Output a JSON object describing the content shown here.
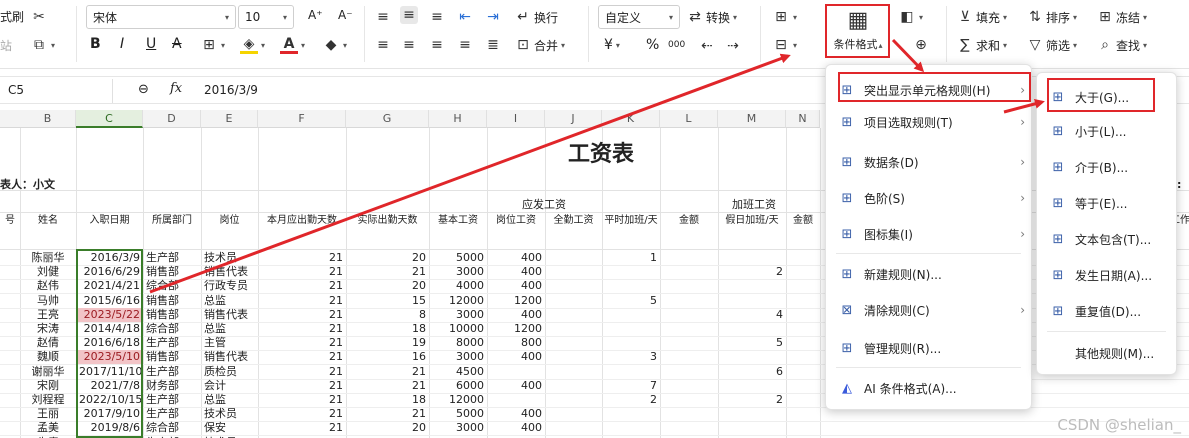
{
  "ribbon": {
    "format_painter": "式刷",
    "paste_partial": "站",
    "font_name": "宋体",
    "font_size": "10",
    "grow_font": "A⁺",
    "shrink_font": "A⁻",
    "bold": "B",
    "italic": "I",
    "underline": "U",
    "strike": "A",
    "number_format": "自定义",
    "convert": "转换",
    "wrap": "换行",
    "merge": "合并",
    "currency": "¥",
    "percent": "%",
    "thousands": "000",
    "cond_format": "条件格式",
    "fill": "填充",
    "sum": "求和",
    "sort": "排序",
    "filter": "筛选",
    "freeze": "冻结",
    "find": "查找",
    "colors": {
      "highlight": "#f5d400",
      "font": "#e0262a",
      "accent_red": "#e0262a"
    }
  },
  "formula_bar": {
    "cell_ref": "C5",
    "fx": "fx",
    "value": "2016/3/9"
  },
  "columns": [
    "B",
    "C",
    "D",
    "E",
    "F",
    "G",
    "H",
    "I",
    "J",
    "K",
    "L",
    "M",
    "N"
  ],
  "sheet": {
    "title": "工资表",
    "creator": "表人：小文",
    "right_fragment": "计:",
    "group_headers": {
      "wage": "应发工资",
      "overtime": "加班工资"
    },
    "headers": [
      "号",
      "姓名",
      "入职日期",
      "所属部门",
      "岗位",
      "本月应出勤天数",
      "实际出勤天数",
      "基本工资",
      "岗位工资",
      "全勤工资",
      "平时加班/天",
      "金额",
      "假日加班/天",
      "金额",
      "工作"
    ],
    "rows": [
      [
        "",
        "陈丽华",
        "2016/3/9",
        "生产部",
        "技术员",
        "21",
        "20",
        "5000",
        "400",
        "",
        "1",
        "",
        "",
        ""
      ],
      [
        "",
        "刘健",
        "2016/6/29",
        "销售部",
        "销售代表",
        "21",
        "21",
        "3000",
        "400",
        "",
        "",
        "",
        "2",
        ""
      ],
      [
        "",
        "赵伟",
        "2021/4/21",
        "综合部",
        "行政专员",
        "21",
        "20",
        "4000",
        "400",
        "",
        "",
        "",
        "",
        ""
      ],
      [
        "",
        "马帅",
        "2015/6/16",
        "销售部",
        "总监",
        "21",
        "15",
        "12000",
        "1200",
        "",
        "5",
        "",
        "",
        ""
      ],
      [
        "",
        "王亮",
        "2023/5/22",
        "销售部",
        "销售代表",
        "21",
        "8",
        "3000",
        "400",
        "",
        "",
        "",
        "4",
        ""
      ],
      [
        "",
        "宋涛",
        "2014/4/18",
        "综合部",
        "总监",
        "21",
        "18",
        "10000",
        "1200",
        "",
        "",
        "",
        "",
        ""
      ],
      [
        "",
        "赵倩",
        "2016/6/18",
        "生产部",
        "主管",
        "21",
        "19",
        "8000",
        "800",
        "",
        "",
        "",
        "5",
        ""
      ],
      [
        "",
        "魏顺",
        "2023/5/10",
        "销售部",
        "销售代表",
        "21",
        "16",
        "3000",
        "400",
        "",
        "3",
        "",
        "",
        ""
      ],
      [
        "",
        "谢丽华",
        "2017/11/10",
        "生产部",
        "质检员",
        "21",
        "21",
        "4500",
        "",
        "",
        "",
        "",
        "6",
        ""
      ],
      [
        "",
        "宋刚",
        "2021/7/8",
        "财务部",
        "会计",
        "21",
        "21",
        "6000",
        "400",
        "",
        "7",
        "",
        "",
        ""
      ],
      [
        "",
        "刘程程",
        "2022/10/15",
        "生产部",
        "总监",
        "21",
        "18",
        "12000",
        "",
        "",
        "2",
        "",
        "2",
        ""
      ],
      [
        "",
        "王丽",
        "2017/9/10",
        "生产部",
        "技术员",
        "21",
        "21",
        "5000",
        "400",
        "",
        "",
        "",
        "",
        ""
      ],
      [
        "",
        "孟美",
        "2019/8/6",
        "综合部",
        "保安",
        "21",
        "20",
        "3000",
        "400",
        "",
        "",
        "",
        "",
        ""
      ],
      [
        "",
        "朱青",
        "2018/8/18",
        "生产部",
        "技术员",
        "21",
        "21",
        "5000",
        "400",
        "",
        "",
        "",
        "",
        ""
      ]
    ],
    "highlight_rows": [
      4,
      7
    ]
  },
  "menu1": {
    "items": [
      {
        "label": "突出显示单元格规则(H)",
        "icon": "highlight-rules-icon",
        "arrow": true
      },
      {
        "label": "项目选取规则(T)",
        "icon": "top-bottom-rules-icon",
        "arrow": true
      },
      {
        "label": "数据条(D)",
        "icon": "data-bars-icon",
        "arrow": true
      },
      {
        "label": "色阶(S)",
        "icon": "color-scales-icon",
        "arrow": true
      },
      {
        "label": "图标集(I)",
        "icon": "icon-sets-icon",
        "arrow": true
      },
      {
        "label": "新建规则(N)...",
        "icon": "new-rule-icon",
        "arrow": false
      },
      {
        "label": "清除规则(C)",
        "icon": "clear-rules-icon",
        "arrow": true
      },
      {
        "label": "管理规则(R)...",
        "icon": "manage-rules-icon",
        "arrow": false
      },
      {
        "label": "AI 条件格式(A)...",
        "icon": "ai-icon",
        "arrow": false
      }
    ]
  },
  "menu2": {
    "items": [
      {
        "label": "大于(G)...",
        "icon": "greater-than-icon"
      },
      {
        "label": "小于(L)...",
        "icon": "less-than-icon"
      },
      {
        "label": "介于(B)...",
        "icon": "between-icon"
      },
      {
        "label": "等于(E)...",
        "icon": "equal-icon"
      },
      {
        "label": "文本包含(T)...",
        "icon": "text-contains-icon"
      },
      {
        "label": "发生日期(A)...",
        "icon": "date-occurring-icon"
      },
      {
        "label": "重复值(D)...",
        "icon": "duplicate-values-icon"
      },
      {
        "label": "其他规则(M)...",
        "icon": ""
      }
    ]
  },
  "watermark": "CSDN @shelian_"
}
